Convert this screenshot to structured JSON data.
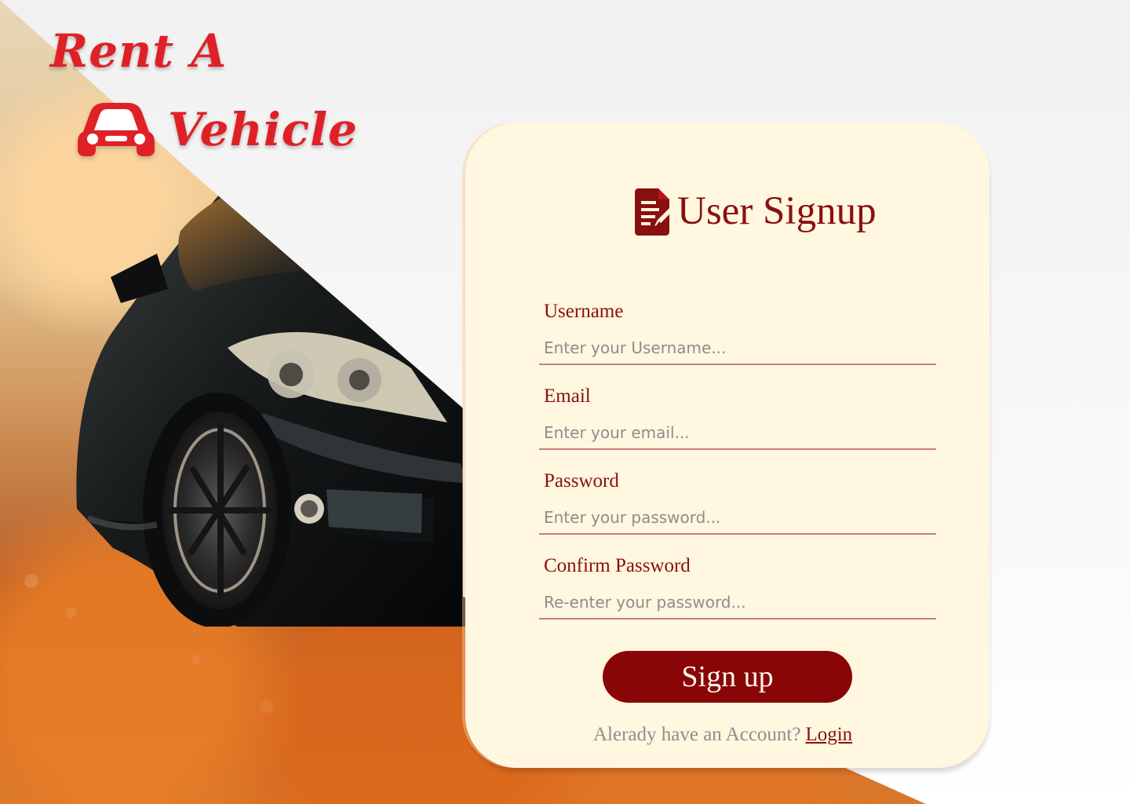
{
  "brand": {
    "line1": "Rent A",
    "line2": "Vehicle"
  },
  "signup": {
    "title": "User Signup",
    "fields": [
      {
        "label": "Username",
        "placeholder": "Enter your Username..."
      },
      {
        "label": "Email",
        "placeholder": "Enter your email..."
      },
      {
        "label": "Password",
        "placeholder": "Enter your password..."
      },
      {
        "label": "Confirm Password",
        "placeholder": "Re-enter your password..."
      }
    ],
    "button_label": "Sign up",
    "account_prompt": "Alerady have an Account?",
    "login_label": "Login"
  },
  "icons": {
    "brand": "car-icon",
    "title": "signup-form-icon"
  },
  "colors": {
    "brand_red": "#df2127",
    "primary_red": "#8a0606",
    "card_background": "#fff7df",
    "input_underline": "#c67e81",
    "muted_text": "#8e8e8e"
  }
}
